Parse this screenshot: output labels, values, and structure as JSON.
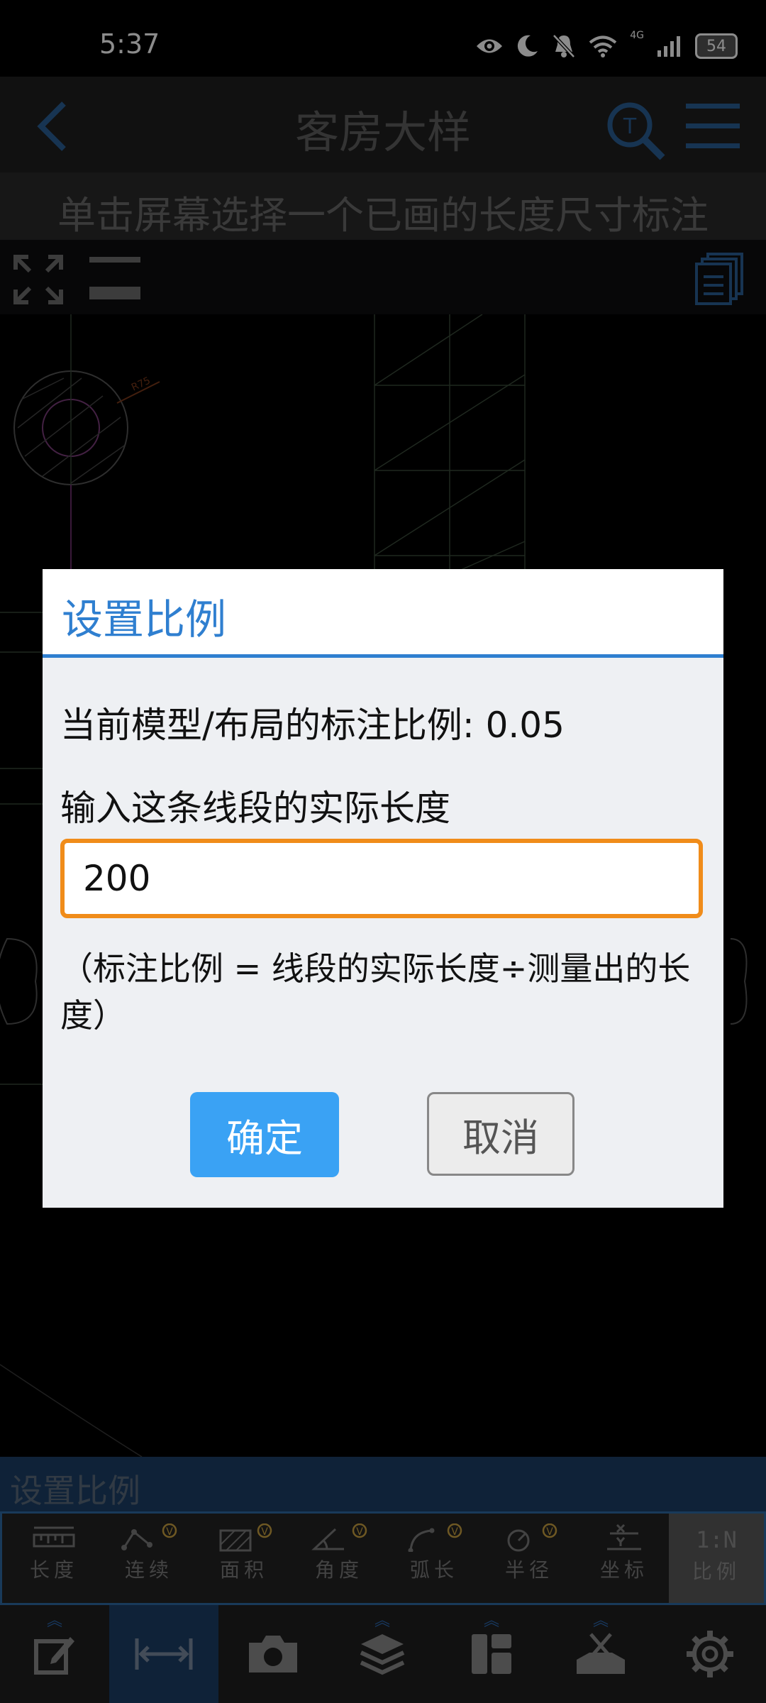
{
  "status": {
    "time": "5:37",
    "network": "4G",
    "battery": "54"
  },
  "titlebar": {
    "title": "客房大样"
  },
  "hint": "单击屏幕选择一个已画的长度尺寸标注",
  "canvas": {
    "dimension_label": "R75"
  },
  "dialog": {
    "title": "设置比例",
    "current_scale": "当前模型/布局的标注比例: 0.05",
    "input_label": "输入这条线段的实际长度",
    "input_value": "200",
    "formula": "（标注比例 = 线段的实际长度÷测量出的长度）",
    "ok": "确定",
    "cancel": "取消"
  },
  "mode_label": "设置比例",
  "measure_tools": [
    {
      "label": "长度",
      "icon": "ruler-icon",
      "vip": false
    },
    {
      "label": "连续",
      "icon": "polyline-icon",
      "vip": true
    },
    {
      "label": "面积",
      "icon": "hatch-area-icon",
      "vip": true
    },
    {
      "label": "角度",
      "icon": "angle-icon",
      "vip": true
    },
    {
      "label": "弧长",
      "icon": "arc-icon",
      "vip": true
    },
    {
      "label": "半径",
      "icon": "radius-icon",
      "vip": true
    },
    {
      "label": "坐标",
      "icon": "coordinate-icon",
      "vip": false
    },
    {
      "label": "比例",
      "icon": "scale-ratio-icon",
      "glyph": "1:N",
      "vip": false,
      "active": true
    }
  ],
  "vip_badge": "V",
  "bottom_nav": [
    {
      "icon": "edit-icon"
    },
    {
      "icon": "dimension-icon",
      "active": true
    },
    {
      "icon": "camera-icon"
    },
    {
      "icon": "layers-icon"
    },
    {
      "icon": "layout-icon"
    },
    {
      "icon": "tools-icon"
    },
    {
      "icon": "settings-icon"
    }
  ],
  "colors": {
    "accent_blue": "#2f7fd0",
    "input_border": "#f08c1a",
    "ok_button": "#3aa2f4",
    "canvas_bg": "#000000"
  }
}
